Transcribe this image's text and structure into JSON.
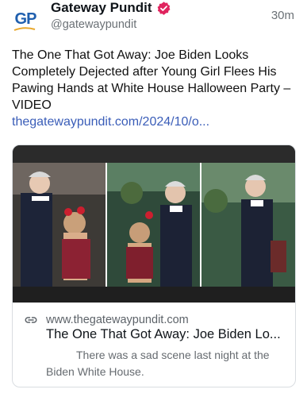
{
  "author": {
    "avatar_text": "GP",
    "name": "Gateway Pundit",
    "handle": "@gatewaypundit",
    "verified_icon": "verified-badge-icon",
    "time": "30m"
  },
  "post": {
    "text": "The One That Got Away: Joe Biden Looks Completely Dejected after Young Girl Flees His Pawing Hands at White House Halloween Party – VIDEO",
    "link": "thegatewaypundit.com/2024/10/o..."
  },
  "card": {
    "domain_icon": "link-icon",
    "domain": "www.thegatewaypundit.com",
    "title": "The One That Got Away: Joe Biden Lo...",
    "description": "There was a sad scene last night at the Biden White House."
  },
  "colors": {
    "brand_blue": "#1f5fae",
    "link_blue": "#3a5db8",
    "verified_red": "#e0245e"
  }
}
